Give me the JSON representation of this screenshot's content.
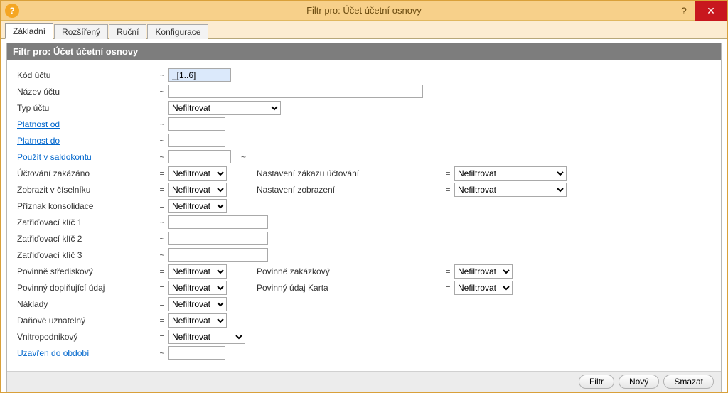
{
  "window": {
    "title": "Filtr pro: Účet účetní osnovy"
  },
  "tabs": {
    "basic": "Základní",
    "extended": "Rozšířený",
    "manual": "Ruční",
    "config": "Konfigurace"
  },
  "panel": {
    "title": "Filtr pro: Účet účetní osnovy"
  },
  "labels": {
    "kod_uctu": "Kód účtu",
    "nazev_uctu": "Název účtu",
    "typ_uctu": "Typ účtu",
    "platnost_od": "Platnost od",
    "platnost_do": "Platnost do",
    "pouzit_v_saldokontu": "Použít v saldokontu",
    "uctovani_zakazano": "Účtování zakázáno",
    "nastaveni_zakazu": "Nastavení zákazu účtování",
    "zobrazit_v_ciselniku": "Zobrazit v číselníku",
    "nastaveni_zobrazeni": "Nastavení zobrazení",
    "priznak_konsolidace": "Příznak konsolidace",
    "zatr1": "Zatřiďovací klíč 1",
    "zatr2": "Zatřiďovací klíč 2",
    "zatr3": "Zatřiďovací klíč 3",
    "pov_strediskovy": "Povinně střediskový",
    "pov_zakazkovy": "Povinně zakázkový",
    "pov_dopln": "Povinný doplňující údaj",
    "pov_karta": "Povinný údaj Karta",
    "naklady": "Náklady",
    "danove_uzn": "Daňově uznatelný",
    "vnitropodnik": "Vnitropodnikový",
    "uzavren_do": "Uzavřen do období"
  },
  "ops": {
    "tilde": "~",
    "eq": "="
  },
  "values": {
    "kod_uctu": "_[1..6]",
    "nazev_uctu": "",
    "typ_uctu": "Nefiltrovat",
    "platnost_od": "",
    "platnost_do": "",
    "saldo1": "",
    "saldo2": "",
    "uctovani_zakazano": "Nefiltrovat",
    "nastaveni_zakazu": "Nefiltrovat",
    "zobrazit_v_ciselniku": "Nefiltrovat",
    "nastaveni_zobrazeni": "Nefiltrovat",
    "priznak_konsolidace": "Nefiltrovat",
    "zatr1": "",
    "zatr2": "",
    "zatr3": "",
    "pov_strediskovy": "Nefiltrovat",
    "pov_zakazkovy": "Nefiltrovat",
    "pov_dopln": "Nefiltrovat",
    "pov_karta": "Nefiltrovat",
    "naklady": "Nefiltrovat",
    "danove_uzn": "Nefiltrovat",
    "vnitropodnik": "Nefiltrovat",
    "uzavren_do": ""
  },
  "buttons": {
    "filter": "Filtr",
    "new": "Nový",
    "clear": "Smazat"
  }
}
